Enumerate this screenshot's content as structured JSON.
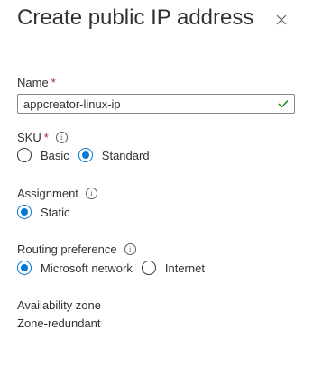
{
  "panel": {
    "title": "Create public IP address"
  },
  "name": {
    "label": "Name",
    "required_mark": "*",
    "value": "appcreator-linux-ip"
  },
  "sku": {
    "label": "SKU",
    "required_mark": "*",
    "options": [
      {
        "label": "Basic",
        "selected": false
      },
      {
        "label": "Standard",
        "selected": true
      }
    ]
  },
  "assignment": {
    "label": "Assignment",
    "options": [
      {
        "label": "Static",
        "selected": true
      }
    ]
  },
  "routing": {
    "label": "Routing preference",
    "options": [
      {
        "label": "Microsoft network",
        "selected": true
      },
      {
        "label": "Internet",
        "selected": false
      }
    ]
  },
  "availability": {
    "label": "Availability zone",
    "value": "Zone-redundant"
  },
  "colors": {
    "accent": "#0078d4",
    "success": "#107c10",
    "required": "#a4262c"
  }
}
